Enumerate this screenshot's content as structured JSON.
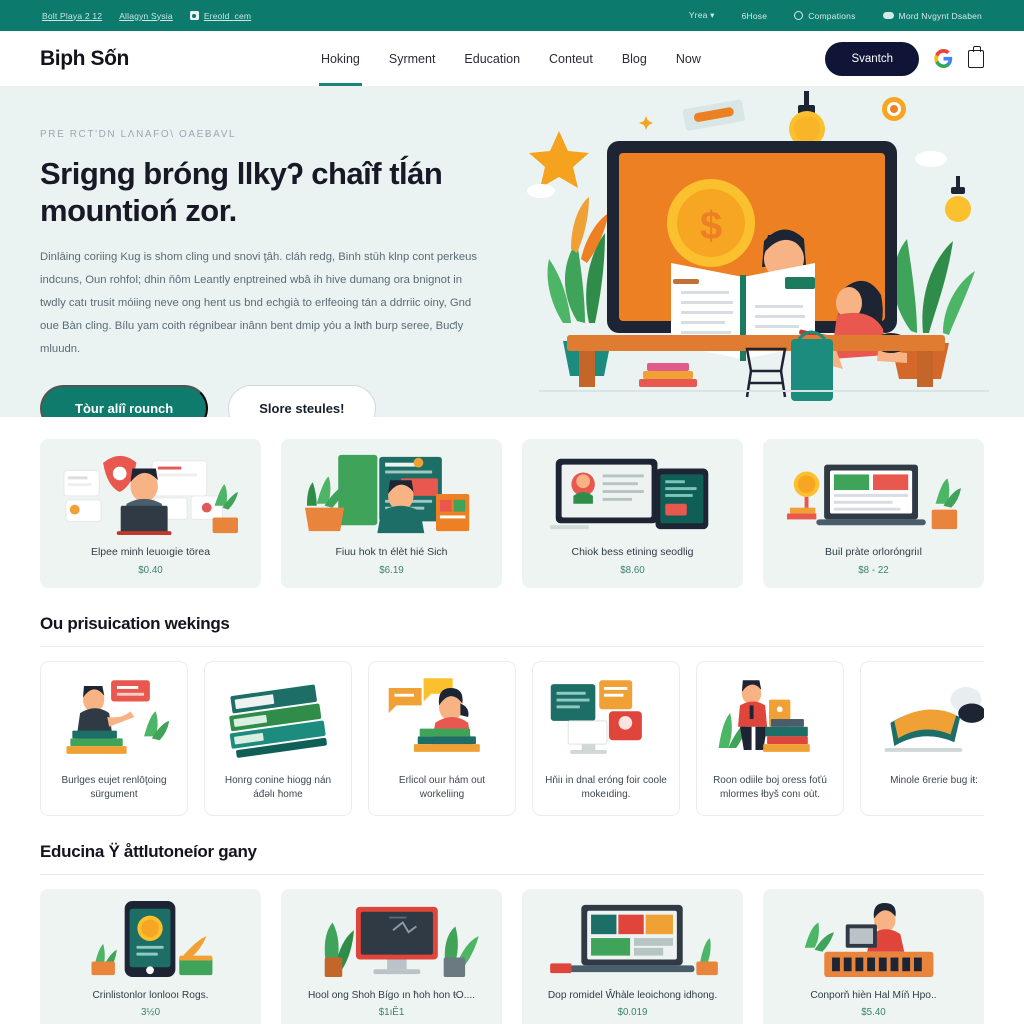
{
  "topbar": {
    "links": [
      {
        "label": "Bolt Playa 2 12",
        "icon": "none"
      },
      {
        "label": "Allagyn Sysia",
        "icon": "none"
      },
      {
        "label": "Ereold_cem",
        "icon": "camera-icon"
      }
    ],
    "right_items": [
      {
        "label": "Yrea ▾",
        "icon": "none"
      },
      {
        "label": "6Hose",
        "icon": "none"
      },
      {
        "label": "Compations",
        "icon": "ring-icon"
      },
      {
        "label": "Mord Nvgynt Dsaben",
        "icon": "toggle-icon"
      }
    ]
  },
  "header": {
    "logo": "Biph Sốn",
    "nav": [
      {
        "label": "Hoking",
        "active": true
      },
      {
        "label": "Syrment",
        "active": false
      },
      {
        "label": "Education",
        "active": false
      },
      {
        "label": "Conteut",
        "active": false
      },
      {
        "label": "Blog",
        "active": false
      },
      {
        "label": "Now",
        "active": false
      }
    ],
    "cta_label": "Svantch",
    "google_icon": "google-icon",
    "bag_icon": "shopping-bag-icon"
  },
  "hero": {
    "eyebrow": "PRE RCT'DN LΛNAFO\\ OAEɃAVL",
    "heading": "Srigng bróng llkyʔ chaîf tĺán mountioń zor.",
    "paragraph": "Dinlāing coriing Kug is shom cling und snovi ţâh. cláh redg, Binh stūh klnp cont perkeus indcuns, Oun rohfol; dhin ňôm Leantly enptreined wbâ ih hive dumang ora bnignot in twdly catı trusit móiing neve ong hent us bnd echgià to erlfeoing tán a ddrriic oiny, Gnd oue Bàn cling. Bílu уam coith régnibear inânn bent dmip yóu a lɴtħ burp seree, Buƈly mluudn.",
    "primary_button": "Tòur alíî rounch",
    "secondary_button": "Slore steules!"
  },
  "featured_row": {
    "cards": [
      {
        "title": "Elpee minh leuoıgie törea",
        "price": "$0.40",
        "art": "person-laptop-illustration"
      },
      {
        "title": "Fiuu hok tn élèt hié Sich",
        "price": "$6.19",
        "art": "person-board-illustration"
      },
      {
        "title": "Chiok bess etining seodlig",
        "price": "$8.60",
        "art": "devices-illustration"
      },
      {
        "title": "Buil pràte orloróngriıl",
        "price": "$8 - 22",
        "art": "laptop-books-illustration"
      }
    ]
  },
  "section_two": {
    "heading": "Ou prisuication wekings",
    "cards": [
      {
        "title": "Burlges eujet renlōţoing sürgument",
        "art": "man-books-laptop-illustration"
      },
      {
        "title": "Honrg conine hiogg nán áđəlı ħome",
        "art": "stacked-books-illustration"
      },
      {
        "title": "Erlicol ouır hám out workeliing",
        "art": "woman-reading-illustration"
      },
      {
        "title": "Hňiı in dnal eróng foir coole mokeıding.",
        "art": "screen-chat-illustration"
      },
      {
        "title": "Roon odiile boj oress foťú mlormes łbyš conı oùt.",
        "art": "man-book-stack-illustration"
      },
      {
        "title": "Minole 6rerie bug iŧ:",
        "art": "open-book-illustration"
      }
    ]
  },
  "section_three": {
    "heading": "Educina Ÿ åttlutoneíor gany",
    "cards": [
      {
        "title": "Crinlistonlor lonlooı Rogs.",
        "price": "3½0",
        "art": "phone-coin-illustration"
      },
      {
        "title": "Hool ong Shoh Bígo ın ħoh hon ŧO....",
        "price": "$1ıĔ1",
        "art": "imac-plants-illustration"
      },
      {
        "title": "Dop romidel Ŵhàle leoichong idhong.",
        "price": "$0.019",
        "art": "laptop-colorful-illustration"
      },
      {
        "title": "Conporň hièn Hal Míň Hpo..",
        "price": "$5.40",
        "art": "desk-worker-illustration"
      }
    ]
  },
  "colors": {
    "teal_dark": "#0d7a6e",
    "teal": "#0f7b6c",
    "navy": "#101436",
    "hero_bg": "#eaf3f2",
    "card_bg": "#eef4f2",
    "price_green": "#39836f",
    "orange": "#ee8024",
    "yellow": "#f7b731",
    "red": "#e0453b",
    "leaf_green": "#3fa35a"
  }
}
